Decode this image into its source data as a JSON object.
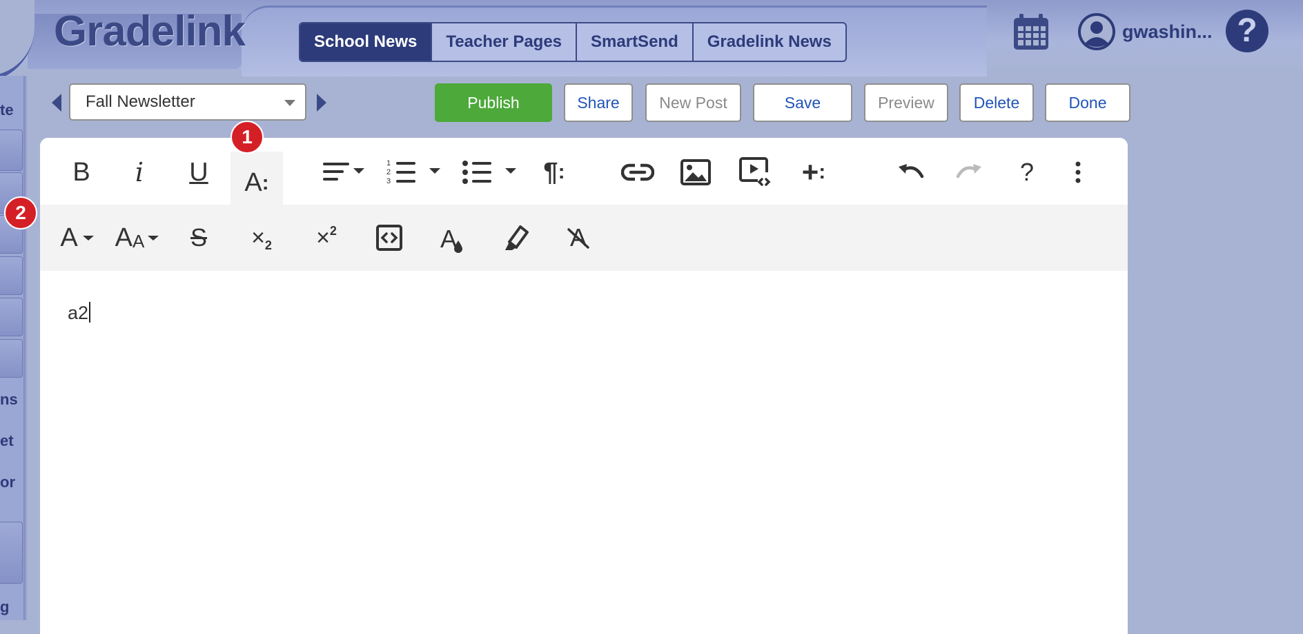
{
  "app": {
    "name": "Gradelink"
  },
  "nav": {
    "tabs": [
      {
        "label": "School News",
        "active": true
      },
      {
        "label": "Teacher Pages",
        "active": false
      },
      {
        "label": "SmartSend",
        "active": false
      },
      {
        "label": "Gradelink News",
        "active": false
      }
    ]
  },
  "header": {
    "username": "gwashin...",
    "help_label": "?"
  },
  "sidebar": {
    "labels": [
      "te",
      "ns",
      "et",
      "or",
      "g"
    ]
  },
  "toolbar": {
    "post_select_value": "Fall Newsletter",
    "publish_label": "Publish",
    "share_label": "Share",
    "new_post_label": "New Post",
    "save_label": "Save",
    "preview_label": "Preview",
    "delete_label": "Delete",
    "done_label": "Done"
  },
  "editor": {
    "content": "a2",
    "icons_row1": [
      "bold-icon",
      "italic-icon",
      "underline-icon",
      "text-format-more-icon",
      "align-icon",
      "ordered-list-icon",
      "unordered-list-icon",
      "paragraph-format-icon",
      "link-icon",
      "image-icon",
      "video-icon",
      "insert-more-icon",
      "undo-icon",
      "redo-icon",
      "help-icon",
      "more-vertical-icon"
    ],
    "icons_row2": [
      "font-family-icon",
      "font-size-icon",
      "strikethrough-icon",
      "subscript-icon",
      "superscript-icon",
      "inline-code-icon",
      "text-color-icon",
      "highlight-icon",
      "clear-format-icon"
    ],
    "letters": {
      "bold": "B",
      "italic": "i",
      "underline": "U",
      "text_more": "A",
      "paragraph": "¶",
      "insert_more": "+",
      "help": "?",
      "font_family": "A",
      "font_size_big": "A",
      "font_size_small": "A",
      "strike": "S",
      "sub_base": "×",
      "sub_script": "2",
      "sup_base": "×",
      "sup_script": "2",
      "text_color": "A",
      "clear_format": "A"
    }
  },
  "badges": [
    {
      "label": "1"
    },
    {
      "label": "2"
    }
  ],
  "colors": {
    "brand_navy": "#2d3b7a",
    "publish_green": "#4ca93a",
    "link_blue": "#2154b8",
    "badge_red": "#d51f26"
  }
}
